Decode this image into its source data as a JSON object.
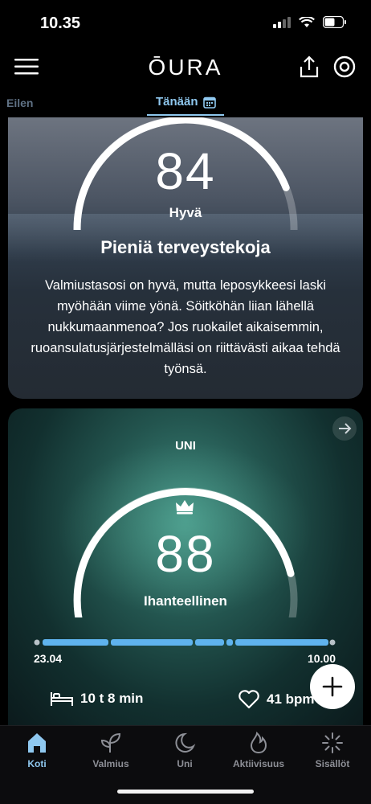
{
  "status_bar": {
    "time": "10.35"
  },
  "header": {
    "logo": "ŌURA"
  },
  "tabs": {
    "previous": "Eilen",
    "current": "Tänään"
  },
  "readiness_card": {
    "score": "84",
    "score_value": 84,
    "rating": "Hyvä",
    "title": "Pieniä terveystekoja",
    "body": "Valmiustasosi on hyvä, mutta leposykkeesi laski myöhään viime yönä. Söitköhän liian lähellä nukkumaanmenoa? Jos ruokailet aikaisemmin, ruoansulatusjärjestelmälläsi on riittävästi aikaa tehdä työnsä."
  },
  "sleep_card": {
    "title": "UNI",
    "score": "88",
    "score_value": 88,
    "rating": "Ihanteellinen",
    "start_date": "23.04",
    "end_time": "10.00",
    "duration": "10 t 8 min",
    "heart_rate": "41 bpm"
  },
  "bottom_nav": [
    {
      "label": "Koti",
      "icon": "home-icon",
      "active": true
    },
    {
      "label": "Valmius",
      "icon": "sprout-icon",
      "active": false
    },
    {
      "label": "Uni",
      "icon": "moon-icon",
      "active": false
    },
    {
      "label": "Aktiivisuus",
      "icon": "flame-icon",
      "active": false
    },
    {
      "label": "Sisällöt",
      "icon": "sparkle-icon",
      "active": false
    }
  ],
  "colors": {
    "accent": "#8fc8ef",
    "timeline": "#5fb3ee",
    "inactive": "#8d8f96"
  }
}
